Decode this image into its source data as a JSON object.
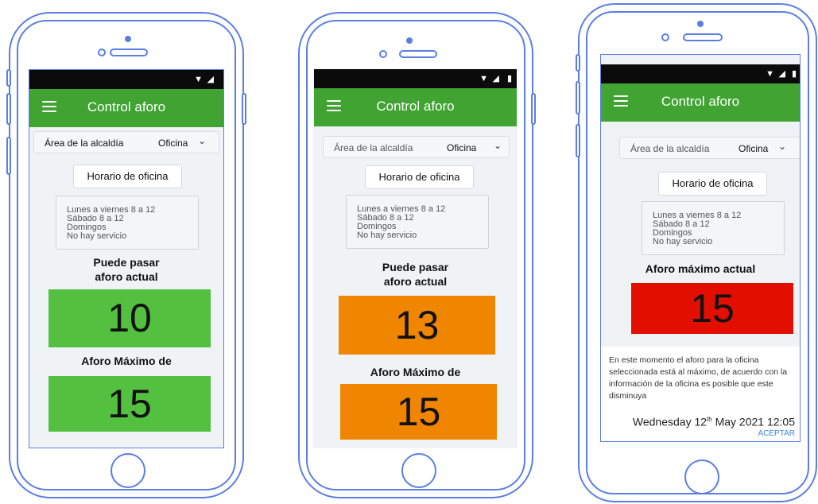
{
  "app": {
    "title": "Control aforo"
  },
  "area_select": {
    "label": "Área de la alcaldía",
    "value": "Oficina"
  },
  "office_hours": {
    "button_label": "Horario de oficina",
    "lines": [
      "Lunes a viernes 8 a 12",
      "Sábado 8 a 12",
      "Domingos",
      "No hay servicio"
    ]
  },
  "phones": [
    {
      "heading_line1": "Puede pasar",
      "heading_line2": "aforo actual",
      "current_value": "10",
      "current_color": "#53c13f",
      "max_label": "Aforo Máximo de",
      "max_value": "15",
      "max_color": "#53c13f"
    },
    {
      "heading_line1": "Puede pasar",
      "heading_line2": "aforo actual",
      "current_value": "13",
      "current_color": "#f08500",
      "max_label": "Aforo Máximo de",
      "max_value": "15",
      "max_color": "#f08500"
    },
    {
      "heading": "Aforo máximo actual",
      "current_value": "15",
      "current_color": "#e20f00",
      "message": "En este momento el aforo para la oficina seleccionada está al máximo, de acuerdo con la información de la oficina es posible que este disminuya",
      "date_prefix": "Wednesday 12",
      "date_suffix": "th",
      "date_rest": " May 2021 12:05",
      "accept_label": "ACEPTAR"
    }
  ],
  "icons": {
    "wifi": "wifi-icon",
    "signal": "signal-icon",
    "battery": "battery-icon",
    "menu": "menu-icon",
    "chevron": "chevron-down-icon"
  }
}
